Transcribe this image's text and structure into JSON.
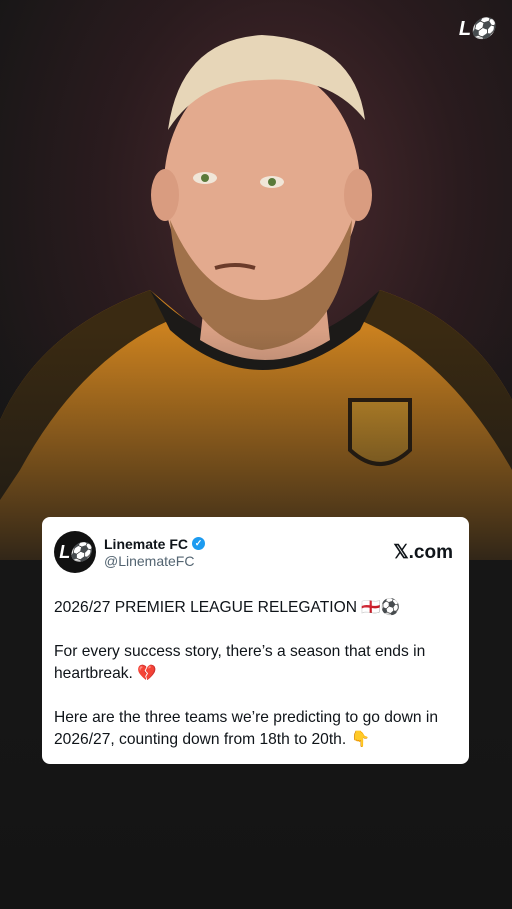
{
  "brand": {
    "logo_text": "L⚽"
  },
  "post": {
    "avatar_text": "L⚽",
    "display_name": "Linemate FC",
    "verified_icon": "verified-badge-icon",
    "handle": "@LinemateFC",
    "source": "𝕏.com",
    "line1": "2026/27 PREMIER LEAGUE RELEGATION 🏴󠁧󠁢󠁥󠁮󠁧󠁿⚽",
    "line2": "For every success story, there’s a season that ends in heartbreak. 💔",
    "line3": "Here are the three teams we’re predicting to go down in 2026/27, counting down from 18th to 20th. 👇"
  },
  "colors": {
    "verified": "#1d9bf0",
    "background": "#161616",
    "card": "#ffffff"
  }
}
